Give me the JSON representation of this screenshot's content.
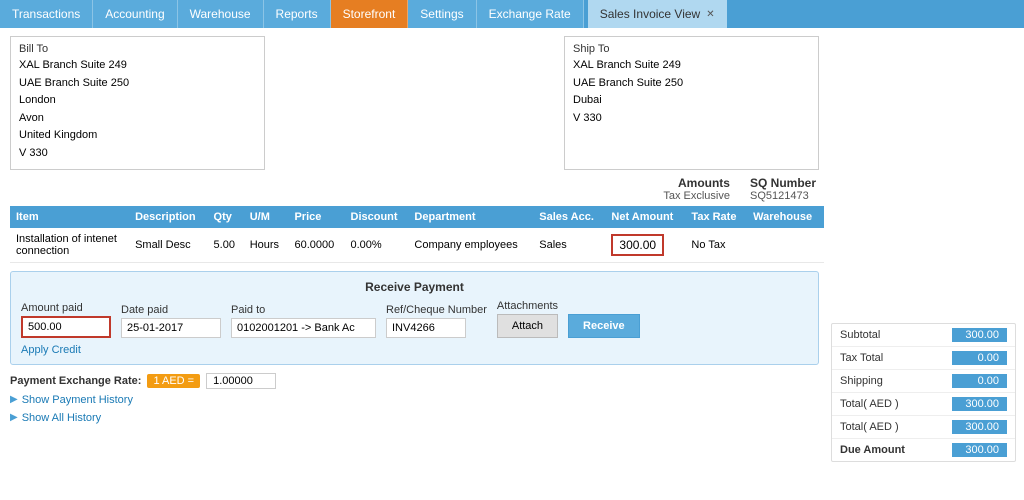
{
  "nav": {
    "tabs": [
      {
        "label": "Transactions",
        "active": false
      },
      {
        "label": "Accounting",
        "active": false
      },
      {
        "label": "Warehouse",
        "active": false
      },
      {
        "label": "Reports",
        "active": false
      },
      {
        "label": "Storefront",
        "active": true
      },
      {
        "label": "Settings",
        "active": false
      },
      {
        "label": "Exchange Rate",
        "active": false
      },
      {
        "label": "Sales Invoice View",
        "active": false,
        "closeable": true
      }
    ]
  },
  "bill_to": {
    "label": "Bill To",
    "lines": [
      "XAL Branch Suite 249",
      "UAE Branch Suite 250",
      "London",
      "Avon",
      "United Kingdom",
      "V 330"
    ]
  },
  "ship_to": {
    "label": "Ship To",
    "lines": [
      "XAL Branch Suite 249",
      "UAE Branch Suite 250",
      "Dubai",
      "V 330"
    ]
  },
  "amounts": {
    "title": "Amounts",
    "sub": "Tax Exclusive",
    "sq_label": "SQ Number",
    "sq_value": "SQ5121473"
  },
  "table": {
    "headers": [
      "Item",
      "Description",
      "Qty",
      "U/M",
      "Price",
      "Discount",
      "Department",
      "Sales Acc.",
      "Net Amount",
      "Tax Rate",
      "Warehouse"
    ],
    "rows": [
      {
        "item": "Installation of intenet connection",
        "description": "Small Desc",
        "qty": "5.00",
        "um": "Hours",
        "price": "60.0000",
        "discount": "0.00%",
        "department": "Company employees",
        "sales_acc": "Sales",
        "net_amount": "300.00",
        "tax_rate": "No Tax",
        "warehouse": ""
      }
    ]
  },
  "receive_payment": {
    "title": "Receive Payment",
    "fields": {
      "amount_paid_label": "Amount paid",
      "amount_paid_value": "500.00",
      "date_paid_label": "Date paid",
      "date_paid_value": "25-01-2017",
      "paid_to_label": "Paid to",
      "paid_to_value": "0102001201 -> Bank Ac",
      "ref_label": "Ref/Cheque Number",
      "ref_value": "INV4266",
      "attachments_label": "Attachments"
    },
    "attach_label": "Attach",
    "receive_label": "Receive",
    "apply_credit_label": "Apply Credit"
  },
  "exchange_rate": {
    "label": "Payment Exchange Rate:",
    "badge": "1 AED =",
    "value": "1.00000"
  },
  "show_payment_history": "Show Payment History",
  "show_all_history": "Show All History",
  "summary": {
    "rows": [
      {
        "label": "Subtotal",
        "value": "300.00"
      },
      {
        "label": "Tax Total",
        "value": "0.00"
      },
      {
        "label": "Shipping",
        "value": "0.00"
      },
      {
        "label": "Total( AED )",
        "value": "300.00"
      },
      {
        "label": "Total( AED )",
        "value": "300.00"
      },
      {
        "label": "Due Amount",
        "value": "300.00"
      }
    ]
  }
}
